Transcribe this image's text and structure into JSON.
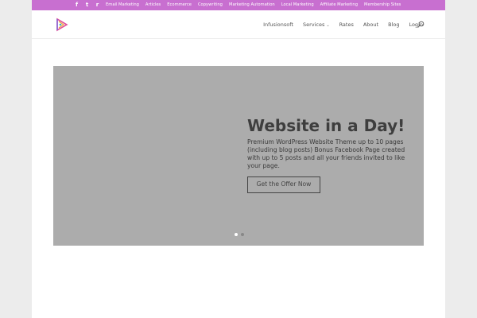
{
  "social": [
    {
      "icon": "facebook-icon",
      "glyph": "f"
    },
    {
      "icon": "twitter-icon",
      "glyph": "t"
    },
    {
      "icon": "rss-icon",
      "glyph": "r"
    }
  ],
  "secondary_nav": [
    "Email Marketing",
    "Articles",
    "Ecommerce",
    "Copywriting",
    "Marketing Automation",
    "Local Marketing",
    "Affiliate Marketing",
    "Membership Sites"
  ],
  "main_nav": {
    "items": [
      "Infusionsoft",
      "Services",
      "Rates",
      "About",
      "Blog",
      "Login"
    ],
    "services_chevron": "⌄"
  },
  "slide": {
    "title": "Website in a Day!",
    "body": "Premium WordPress Website Theme up to 10 pages (including blog posts) Bonus Facebook Page created with up to 5 posts and all your friends invited to like your page.",
    "cta": "Get the Offer Now"
  },
  "slider": {
    "count": 2,
    "active_index": 0
  },
  "colors": {
    "topbar": "#c86fd0",
    "slider_bg": "#acacac"
  }
}
